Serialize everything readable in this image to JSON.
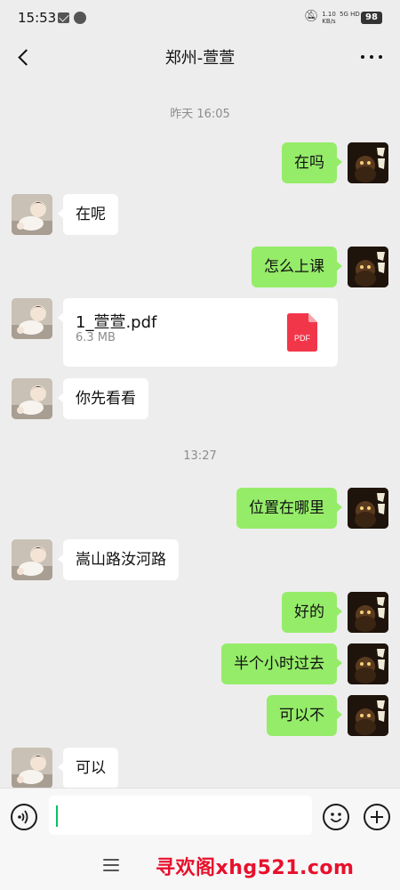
{
  "status_bar": {
    "time": "15:53",
    "net_speed_value": "1.10",
    "net_speed_unit": "KB/s",
    "network": "5G HD",
    "battery": "98"
  },
  "header": {
    "title": "郑州-萱萱"
  },
  "messages": [
    {
      "kind": "time",
      "text": "昨天 16:05"
    },
    {
      "kind": "text",
      "from": "self",
      "text": "在吗"
    },
    {
      "kind": "text",
      "from": "other",
      "text": "在呢"
    },
    {
      "kind": "text",
      "from": "self",
      "text": "怎么上课"
    },
    {
      "kind": "file",
      "from": "other",
      "file_name": "1_萱萱.pdf",
      "file_size": "6.3 MB",
      "file_type": "PDF"
    },
    {
      "kind": "text",
      "from": "other",
      "text": "你先看看"
    },
    {
      "kind": "time",
      "text": "13:27"
    },
    {
      "kind": "text",
      "from": "self",
      "text": "位置在哪里"
    },
    {
      "kind": "text",
      "from": "other",
      "text": "嵩山路汝河路"
    },
    {
      "kind": "text",
      "from": "self",
      "text": "好的"
    },
    {
      "kind": "text",
      "from": "self",
      "text": "半个小时过去"
    },
    {
      "kind": "text",
      "from": "self",
      "text": "可以不"
    },
    {
      "kind": "text",
      "from": "other",
      "text": "可以"
    }
  ],
  "input_bar": {
    "value": ""
  },
  "nav_bar": {
    "watermark": "寻欢阁xhg521.com"
  },
  "icons": {
    "back": "chevron-left-icon",
    "more": "more-dots-icon",
    "voice": "voice-icon",
    "emoji": "emoji-icon",
    "plus": "plus-icon",
    "pdf": "pdf-file-icon"
  },
  "colors": {
    "background": "#ededed",
    "outgoing_bubble": "#95ec69",
    "incoming_bubble": "#ffffff",
    "pdf_red": "#f2364a",
    "watermark_red": "#e8102c"
  }
}
